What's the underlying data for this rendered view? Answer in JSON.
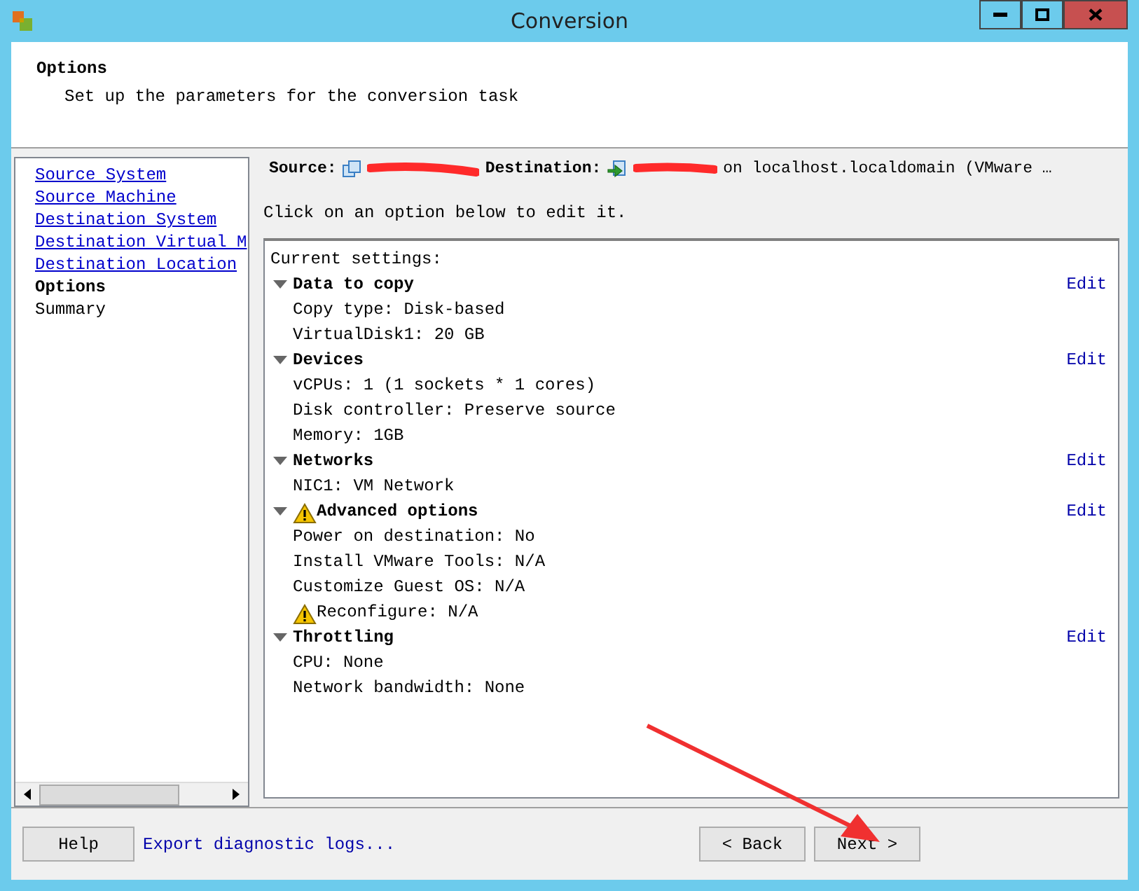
{
  "window": {
    "title": "Conversion"
  },
  "header": {
    "title": "Options",
    "subtitle": "Set up the parameters for the conversion task"
  },
  "steps": [
    {
      "label": "Source System",
      "kind": "link",
      "selected": false
    },
    {
      "label": "Source Machine",
      "kind": "link",
      "selected": false
    },
    {
      "label": "Destination System",
      "kind": "link",
      "selected": false
    },
    {
      "label": "Destination Virtual M",
      "kind": "link",
      "selected": false
    },
    {
      "label": "Destination Location",
      "kind": "link",
      "selected": false
    },
    {
      "label": "Options",
      "kind": "plain",
      "selected": true
    },
    {
      "label": "Summary",
      "kind": "plain",
      "selected": false
    }
  ],
  "summary": {
    "source_label": "Source:",
    "destination_label": "Destination:",
    "destination_text": "on localhost.localdomain (VMware …"
  },
  "instruction": "Click on an option below to edit it.",
  "settings": {
    "heading": "Current settings:",
    "sections": [
      {
        "title": "Data to copy",
        "expanded": true,
        "warning": false,
        "edit": "Edit",
        "items": [
          {
            "text": "Copy type: Disk-based",
            "warning": false
          },
          {
            "text": "VirtualDisk1: 20 GB",
            "warning": false
          }
        ]
      },
      {
        "title": "Devices",
        "expanded": true,
        "warning": false,
        "edit": "Edit",
        "items": [
          {
            "text": "vCPUs: 1 (1 sockets * 1 cores)",
            "warning": false
          },
          {
            "text": "Disk controller: Preserve source",
            "warning": false
          },
          {
            "text": "Memory: 1GB",
            "warning": false
          }
        ]
      },
      {
        "title": "Networks",
        "expanded": true,
        "warning": false,
        "edit": "Edit",
        "items": [
          {
            "text": "NIC1: VM Network",
            "warning": false
          }
        ]
      },
      {
        "title": "Advanced options",
        "expanded": true,
        "warning": true,
        "edit": "Edit",
        "items": [
          {
            "text": "Power on destination: No",
            "warning": false
          },
          {
            "text": "Install VMware Tools: N/A",
            "warning": false
          },
          {
            "text": "Customize Guest OS: N/A",
            "warning": false
          },
          {
            "text": "Reconfigure: N/A",
            "warning": true
          }
        ]
      },
      {
        "title": "Throttling",
        "expanded": true,
        "warning": false,
        "edit": "Edit",
        "items": [
          {
            "text": "CPU: None",
            "warning": false
          },
          {
            "text": "Network bandwidth: None",
            "warning": false
          }
        ]
      }
    ]
  },
  "footer": {
    "help": "Help",
    "export": "Export diagnostic logs...",
    "back": "< Back",
    "next": "Next >"
  }
}
